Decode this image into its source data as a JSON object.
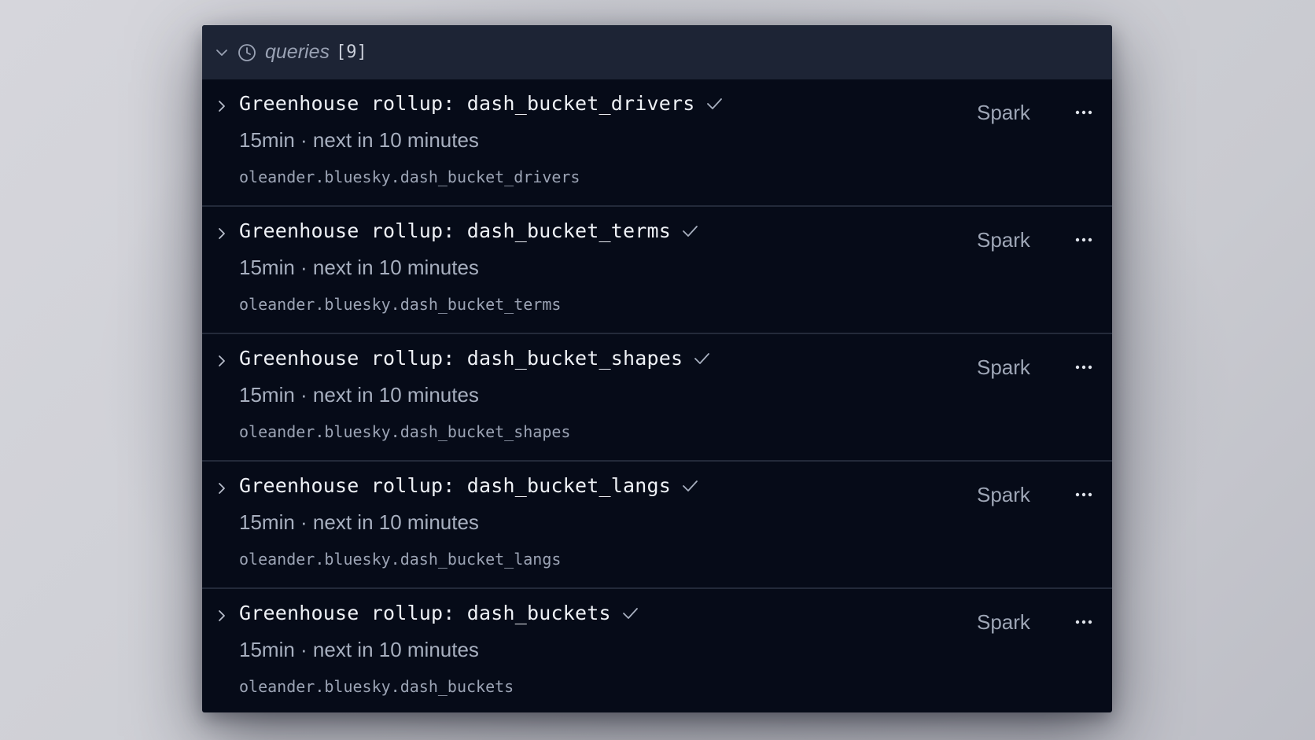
{
  "panel": {
    "title": "queries",
    "count": "[9]",
    "icons": {
      "collapse": "chevron-down-icon",
      "history": "clock-icon"
    }
  },
  "queries": [
    {
      "title": "Greenhouse rollup: dash_bucket_drivers",
      "schedule": "15min · next in 10 minutes",
      "path": "oleander.bluesky.dash_bucket_drivers",
      "engine": "Spark",
      "status": "success"
    },
    {
      "title": "Greenhouse rollup: dash_bucket_terms",
      "schedule": "15min · next in 10 minutes",
      "path": "oleander.bluesky.dash_bucket_terms",
      "engine": "Spark",
      "status": "success"
    },
    {
      "title": "Greenhouse rollup: dash_bucket_shapes",
      "schedule": "15min · next in 10 minutes",
      "path": "oleander.bluesky.dash_bucket_shapes",
      "engine": "Spark",
      "status": "success"
    },
    {
      "title": "Greenhouse rollup: dash_bucket_langs",
      "schedule": "15min · next in 10 minutes",
      "path": "oleander.bluesky.dash_bucket_langs",
      "engine": "Spark",
      "status": "success"
    },
    {
      "title": "Greenhouse rollup: dash_buckets",
      "schedule": "15min · next in 10 minutes",
      "path": "oleander.bluesky.dash_buckets",
      "engine": "Spark",
      "status": "success"
    }
  ],
  "colors": {
    "panel_bg": "#060b18",
    "header_bg": "#1d2435",
    "divider": "#232a3a",
    "title_text": "#eef1f6",
    "muted_text": "#a7afbf"
  }
}
